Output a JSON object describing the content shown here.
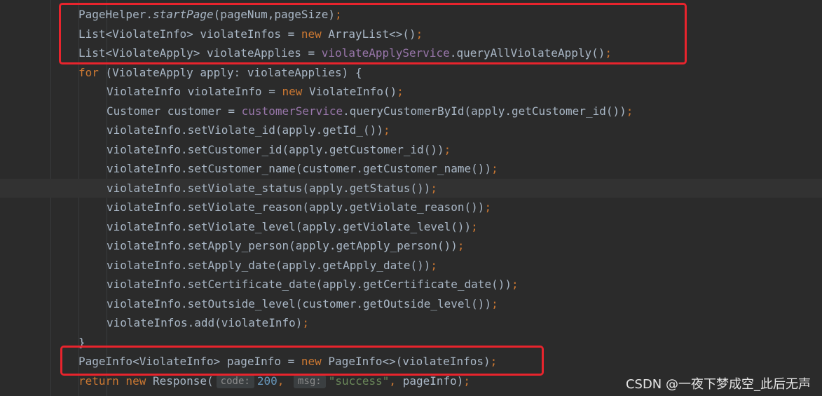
{
  "editor": {
    "current_line_index": 9,
    "lines": [
      [
        {
          "t": "PageHelper.",
          "c": "plain"
        },
        {
          "t": "startPage",
          "c": "italic"
        },
        {
          "t": "(pageNum,pageSize)",
          "c": "plain"
        },
        {
          "t": ";",
          "c": "kw"
        }
      ],
      [
        {
          "t": "List<ViolateInfo> violateInfos = ",
          "c": "plain"
        },
        {
          "t": "new ",
          "c": "kw"
        },
        {
          "t": "ArrayList<>()",
          "c": "plain"
        },
        {
          "t": ";",
          "c": "kw"
        }
      ],
      [
        {
          "t": "List<ViolateApply> violateApplies = ",
          "c": "plain"
        },
        {
          "t": "violateApplyService",
          "c": "field"
        },
        {
          "t": ".queryAllViolateApply()",
          "c": "plain"
        },
        {
          "t": ";",
          "c": "kw"
        }
      ],
      [
        {
          "t": "for ",
          "c": "kw"
        },
        {
          "t": "(ViolateApply apply: violateApplies) {",
          "c": "plain"
        }
      ],
      [
        {
          "t": "ViolateInfo violateInfo = ",
          "c": "plain"
        },
        {
          "t": "new ",
          "c": "kw"
        },
        {
          "t": "ViolateInfo()",
          "c": "plain"
        },
        {
          "t": ";",
          "c": "kw"
        }
      ],
      [
        {
          "t": "Customer customer = ",
          "c": "plain"
        },
        {
          "t": "customerService",
          "c": "field"
        },
        {
          "t": ".queryCustomerById(apply.getCustomer_id())",
          "c": "plain"
        },
        {
          "t": ";",
          "c": "kw"
        }
      ],
      [
        {
          "t": "violateInfo.setViolate_id(apply.getId_())",
          "c": "plain"
        },
        {
          "t": ";",
          "c": "kw"
        }
      ],
      [
        {
          "t": "violateInfo.setCustomer_id(apply.getCustomer_id())",
          "c": "plain"
        },
        {
          "t": ";",
          "c": "kw"
        }
      ],
      [
        {
          "t": "violateInfo.setCustomer_name(customer.getCustomer_name())",
          "c": "plain"
        },
        {
          "t": ";",
          "c": "kw"
        }
      ],
      [
        {
          "t": "violateInfo.setViolate_status(apply.getStatus())",
          "c": "plain"
        },
        {
          "t": ";",
          "c": "kw"
        }
      ],
      [
        {
          "t": "violateInfo.setViolate_reason(apply.getViolate_reason())",
          "c": "plain"
        },
        {
          "t": ";",
          "c": "kw"
        }
      ],
      [
        {
          "t": "violateInfo.setViolate_level(apply.getViolate_level())",
          "c": "plain"
        },
        {
          "t": ";",
          "c": "kw"
        }
      ],
      [
        {
          "t": "violateInfo.setApply_person(apply.getApply_person())",
          "c": "plain"
        },
        {
          "t": ";",
          "c": "kw"
        }
      ],
      [
        {
          "t": "violateInfo.setApply_date(apply.getApply_date())",
          "c": "plain"
        },
        {
          "t": ";",
          "c": "kw"
        }
      ],
      [
        {
          "t": "violateInfo.setCertificate_date(apply.getCertificate_date())",
          "c": "plain"
        },
        {
          "t": ";",
          "c": "kw"
        }
      ],
      [
        {
          "t": "violateInfo.setOutside_level(customer.getOutside_level())",
          "c": "plain"
        },
        {
          "t": ";",
          "c": "kw"
        }
      ],
      [
        {
          "t": "violateInfos.add(violateInfo)",
          "c": "plain"
        },
        {
          "t": ";",
          "c": "kw"
        }
      ],
      [
        {
          "t": "}",
          "c": "plain"
        }
      ],
      [
        {
          "t": "PageInfo<ViolateInfo> pageInfo = ",
          "c": "plain"
        },
        {
          "t": "new ",
          "c": "kw"
        },
        {
          "t": "PageInfo<>(violateInfos)",
          "c": "plain"
        },
        {
          "t": ";",
          "c": "kw"
        }
      ],
      [
        {
          "t": "return new ",
          "c": "kw"
        },
        {
          "t": "Response(",
          "c": "plain"
        },
        {
          "t": "code:",
          "c": "hint"
        },
        {
          "t": "200",
          "c": "num"
        },
        {
          "t": ", ",
          "c": "kw"
        },
        {
          "t": "msg:",
          "c": "hint"
        },
        {
          "t": "\"success\"",
          "c": "str"
        },
        {
          "t": ", ",
          "c": "kw"
        },
        {
          "t": "pageInfo)",
          "c": "plain"
        },
        {
          "t": ";",
          "c": "kw"
        }
      ]
    ]
  },
  "colors": {
    "background": "#2b2b2b",
    "text": "#a9b7c6",
    "keyword": "#cc7832",
    "field": "#9876aa",
    "string": "#6a8759",
    "number": "#6897bb",
    "highlight_box": "#e8242d"
  },
  "watermark": "CSDN @一夜下梦成空_此后无声"
}
